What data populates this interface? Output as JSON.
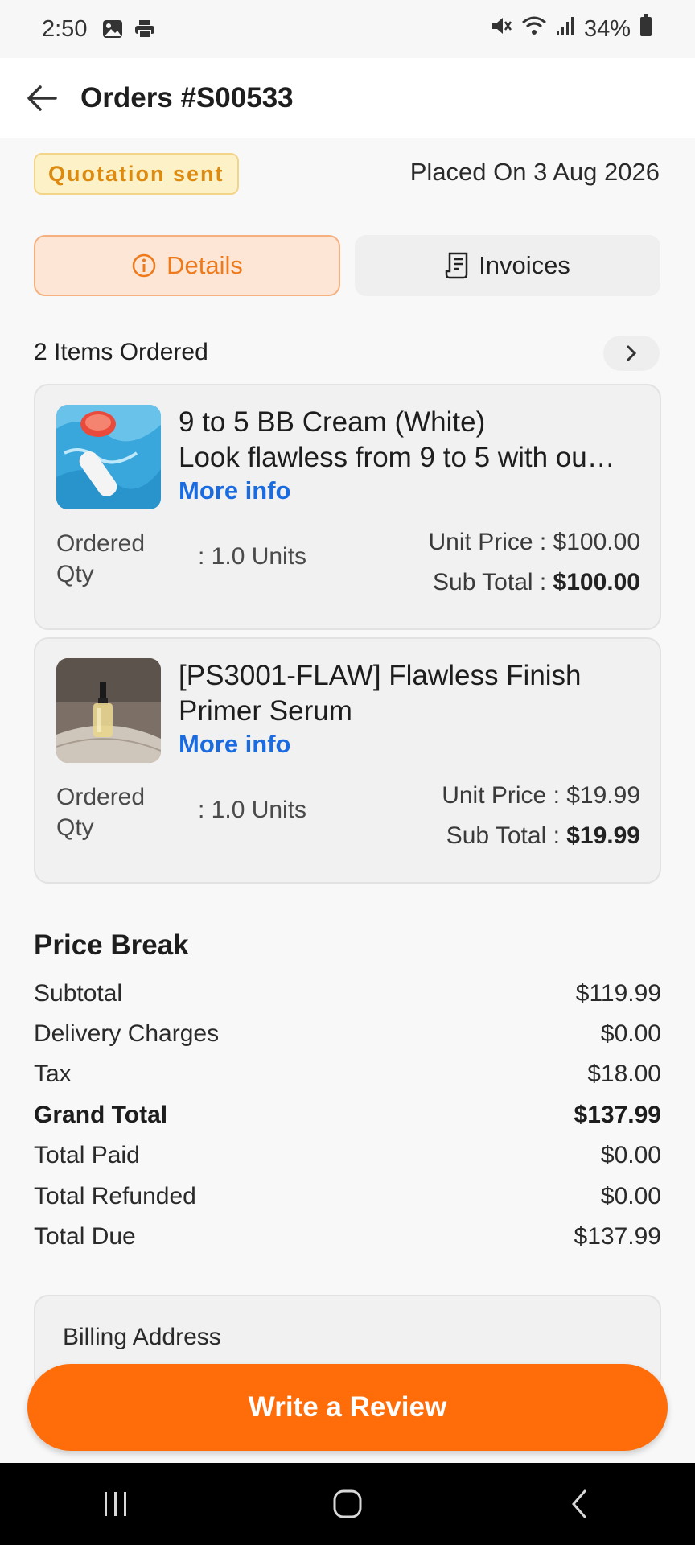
{
  "status_bar": {
    "time": "2:50",
    "battery": "34%",
    "icons": [
      "image-icon",
      "printer-icon",
      "mute-icon",
      "wifi-icon",
      "signal-icon",
      "battery-icon"
    ]
  },
  "header": {
    "title": "Orders #S00533"
  },
  "order": {
    "status": "Quotation sent",
    "placed_on": "Placed On 3 Aug 2026"
  },
  "tabs": [
    {
      "label": "Details",
      "active": true
    },
    {
      "label": "Invoices",
      "active": false
    }
  ],
  "items_header": "2 Items Ordered",
  "items": [
    {
      "name_line1": "9 to 5 BB Cream (White)",
      "name_line2": "Look flawless from 9 to 5 with ou…",
      "more_info": "More info",
      "qty_label": "Ordered Qty",
      "qty_value": ": 1.0 Units",
      "unit_price": "Unit Price : $100.00",
      "sub_total_label": "Sub Total : ",
      "sub_total_value": "$100.00"
    },
    {
      "name_line1": "[PS3001-FLAW] Flawless Finish",
      "name_line2": "Primer Serum",
      "more_info": "More info",
      "qty_label": "Ordered Qty",
      "qty_value": ": 1.0 Units",
      "unit_price": "Unit Price : $19.99",
      "sub_total_label": "Sub Total : ",
      "sub_total_value": "$19.99"
    }
  ],
  "price_break": {
    "title": "Price Break",
    "rows": [
      {
        "label": "Subtotal",
        "value": "$119.99"
      },
      {
        "label": "Delivery Charges",
        "value": "$0.00"
      },
      {
        "label": "Tax",
        "value": "$18.00"
      },
      {
        "label": "Grand Total",
        "value": "$137.99"
      },
      {
        "label": "Total Paid",
        "value": "$0.00"
      },
      {
        "label": "Total Refunded",
        "value": "$0.00"
      },
      {
        "label": "Total Due",
        "value": "$137.99"
      }
    ]
  },
  "billing": {
    "title": "Billing Address"
  },
  "review_button": "Write a Review",
  "colors": {
    "accent": "#ff6d0a",
    "link": "#1a6be0",
    "badge_text": "#dd8a10",
    "badge_bg": "#fdf1c8"
  }
}
